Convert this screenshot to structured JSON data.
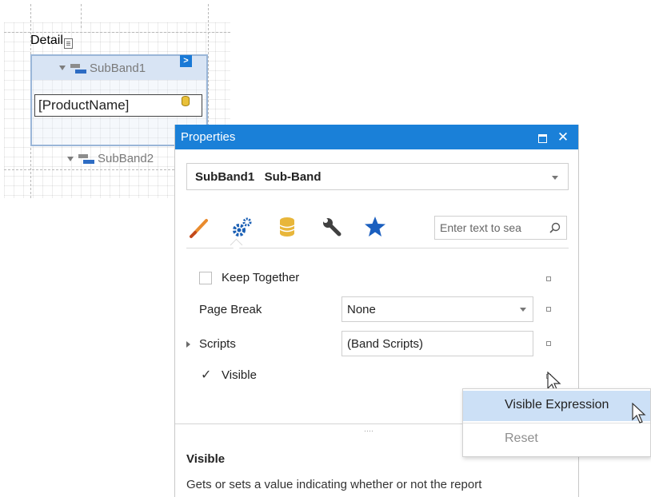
{
  "designer": {
    "detail_band": {
      "label": "Detail"
    },
    "subband1": {
      "label": "SubBand1",
      "smart_tag": ">"
    },
    "field": {
      "text": "[ProductName]"
    },
    "subband2": {
      "label": "SubBand2"
    }
  },
  "properties_panel": {
    "title": "Properties",
    "selector": {
      "value": "SubBand1   Sub-Band"
    },
    "tabs": [
      {
        "icon": "brush-icon",
        "color": "#e98b2e"
      },
      {
        "icon": "gears-icon",
        "color": "#1a5fb4"
      },
      {
        "icon": "database-icon",
        "color": "#e8b63a"
      },
      {
        "icon": "wrench-icon",
        "color": "#404040"
      },
      {
        "icon": "star-icon",
        "color": "#1b5fbf"
      }
    ],
    "search": {
      "placeholder": "Enter text to sea",
      "value": ""
    },
    "properties": [
      {
        "label": "Keep Together",
        "kind": "checkbox",
        "checked": false
      },
      {
        "label": "Page Break",
        "kind": "dropdown",
        "value": "None"
      },
      {
        "label": "Scripts",
        "kind": "expandable",
        "value": "(Band Scripts)"
      },
      {
        "label": "Visible",
        "kind": "checkbox",
        "checked": true
      }
    ],
    "description": {
      "title": "Visible",
      "text": "Gets or sets a value indicating whether or not the report"
    }
  },
  "context_menu": {
    "items": [
      {
        "label": "Visible Expression",
        "state": "hover"
      },
      {
        "label": "Reset",
        "state": "disabled"
      }
    ]
  },
  "colors": {
    "title_bar": "#1a80d8",
    "menu_hover": "#cce0f6",
    "selection_border": "#9ab6d8"
  }
}
